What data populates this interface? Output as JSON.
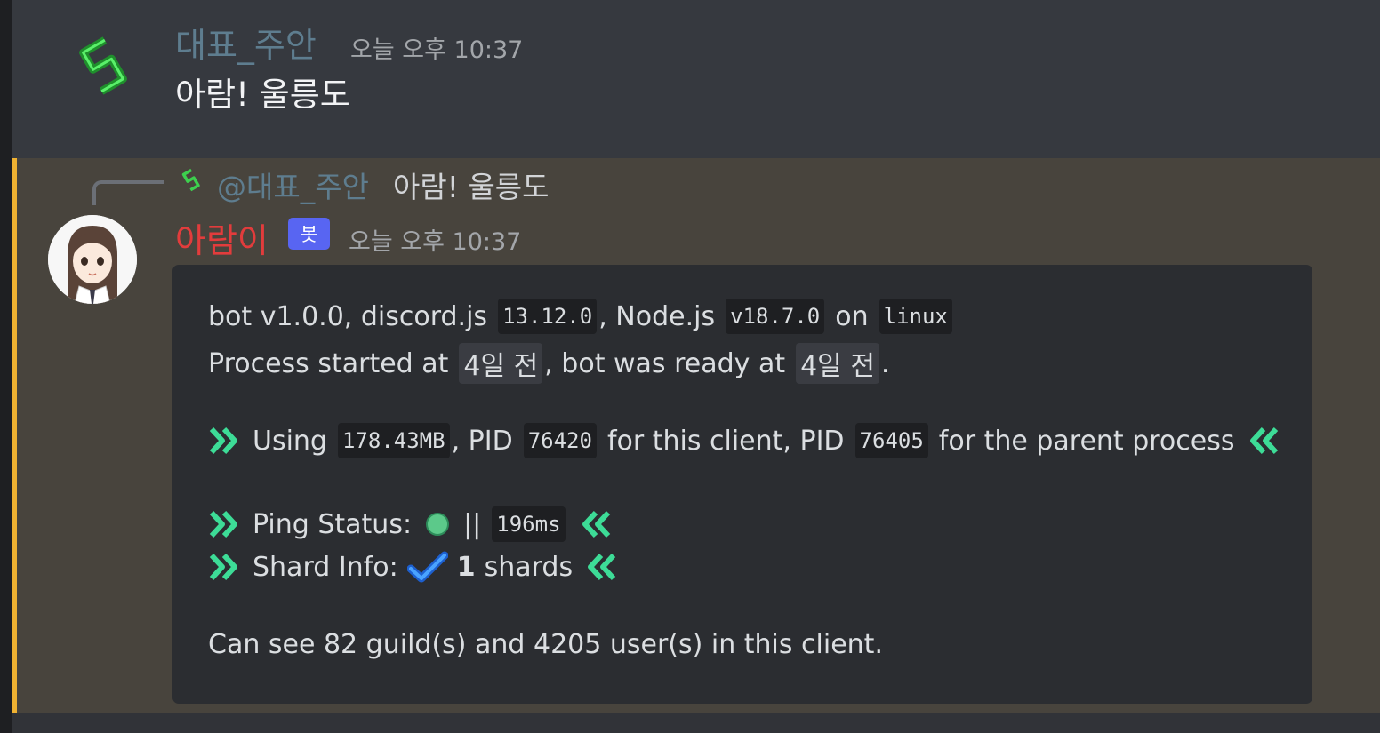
{
  "message1": {
    "author": "대표_주안",
    "timestamp": "오늘 오후 10:37",
    "text": "아람! 울릉도"
  },
  "message2": {
    "reply": {
      "author": "@대표_주안",
      "text": "아람! 울릉도"
    },
    "author": "아람이",
    "bot_tag": "봇",
    "timestamp": "오늘 오후 10:37",
    "embed": {
      "line1": {
        "prefix": "bot v1.0.0, discord.js",
        "discordjs_version": "13.12.0",
        "node_label": ", Node.js",
        "node_version": "v18.7.0",
        "on_label": "on",
        "platform": "linux"
      },
      "line2": {
        "prefix": "Process started at",
        "started": "4일 전",
        "middle": ", bot was ready at",
        "ready": "4일 전",
        "suffix": "."
      },
      "line3": {
        "using": "Using",
        "memory": "178.43MB",
        "pid_label": ", PID",
        "pid": "76420",
        "middle": "for this client, PID",
        "parent_pid": "76405",
        "suffix": "for the parent process"
      },
      "line4": {
        "label": "Ping Status:",
        "separator": "||",
        "ping": "196ms",
        "status_color": "#5cc98a"
      },
      "line5": {
        "label": "Shard Info:",
        "count": "1",
        "unit": "shards"
      },
      "line6": {
        "text": "Can see 82 guild(s) and 4205 user(s) in this client."
      }
    }
  },
  "colors": {
    "accent_bar": "#f0b232",
    "bot_tag": "#5865f2",
    "bot_name": "#e23c3c",
    "user_name": "#5e7d8f",
    "chevron": "#3ddc97"
  }
}
